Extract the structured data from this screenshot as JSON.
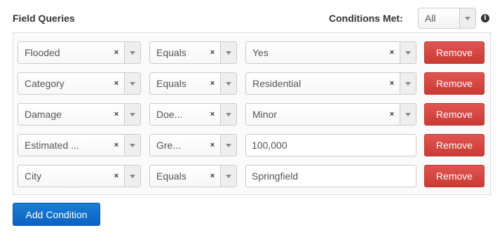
{
  "header": {
    "title": "Field Queries",
    "conditions_met_label": "Conditions Met:",
    "conditions_met_value": "All",
    "info_icon_glyph": "i"
  },
  "clear_glyph": "×",
  "remove_label": "Remove",
  "add_condition_label": "Add Condition",
  "rows": [
    {
      "field": "Flooded",
      "operator": "Equals",
      "value": "Yes",
      "value_type": "select"
    },
    {
      "field": "Category",
      "operator": "Equals",
      "value": "Residential",
      "value_type": "select"
    },
    {
      "field": "Damage",
      "operator": "Doe...",
      "value": "Minor",
      "value_type": "select"
    },
    {
      "field": "Estimated ...",
      "operator": "Gre...",
      "value": "100,000",
      "value_type": "input"
    },
    {
      "field": "City",
      "operator": "Equals",
      "value": "Springfield",
      "value_type": "input"
    }
  ]
}
